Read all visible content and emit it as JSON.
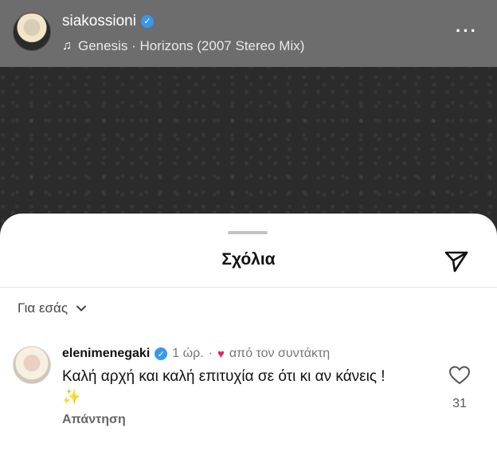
{
  "post": {
    "username": "siakossioni",
    "music": "Genesis · Horizons (2007 Stereo Mix)",
    "more": "···"
  },
  "sheet": {
    "title": "Σχόλια",
    "filter_label": "Για εσάς"
  },
  "comment": {
    "username": "elenimenegaki",
    "time": "1 ώρ.",
    "separator": "·",
    "author_like": "από τον συντάκτη",
    "text": "Καλή αρχή και καλή επιτυχία σε ότι κι αν κάνεις ! ✨",
    "reply_label": "Απάντηση",
    "like_count": "31"
  },
  "colors": {
    "verified": "#3897f0",
    "heart": "#e0245e"
  }
}
